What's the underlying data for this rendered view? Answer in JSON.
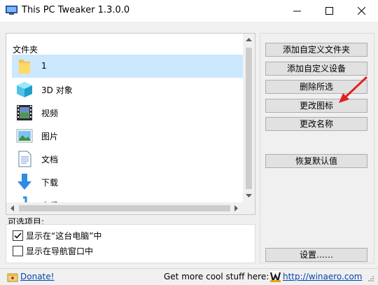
{
  "window": {
    "title": "This PC Tweaker 1.3.0.0"
  },
  "list": {
    "header": "文件夹",
    "items": [
      {
        "label": "1",
        "icon": "folder-icon",
        "selected": true
      },
      {
        "label": "3D 对象",
        "icon": "3d-objects-icon",
        "selected": false
      },
      {
        "label": "视频",
        "icon": "video-icon",
        "selected": false
      },
      {
        "label": "图片",
        "icon": "pictures-icon",
        "selected": false
      },
      {
        "label": "文档",
        "icon": "documents-icon",
        "selected": false
      },
      {
        "label": "下载",
        "icon": "downloads-icon",
        "selected": false
      },
      {
        "label": "音乐",
        "icon": "music-icon",
        "selected": false
      }
    ]
  },
  "options": {
    "label": "可选项目:",
    "items": [
      {
        "label": "显示在“这台电脑”中",
        "checked": true
      },
      {
        "label": "显示在导航窗口中",
        "checked": false
      }
    ]
  },
  "buttons": {
    "add_folder": "添加自定义文件夹",
    "add_device": "添加自定义设备",
    "delete": "删除所选",
    "change_icon": "更改图标",
    "rename": "更改名称",
    "restore": "恢复默认值",
    "settings": "设置……"
  },
  "footer": {
    "donate": "Donate!",
    "more": "Get more cool stuff here:",
    "url": "http://winaero.com"
  },
  "colors": {
    "selection": "#cce8ff",
    "link": "#0645ad",
    "annotation_arrow": "#e02020"
  }
}
